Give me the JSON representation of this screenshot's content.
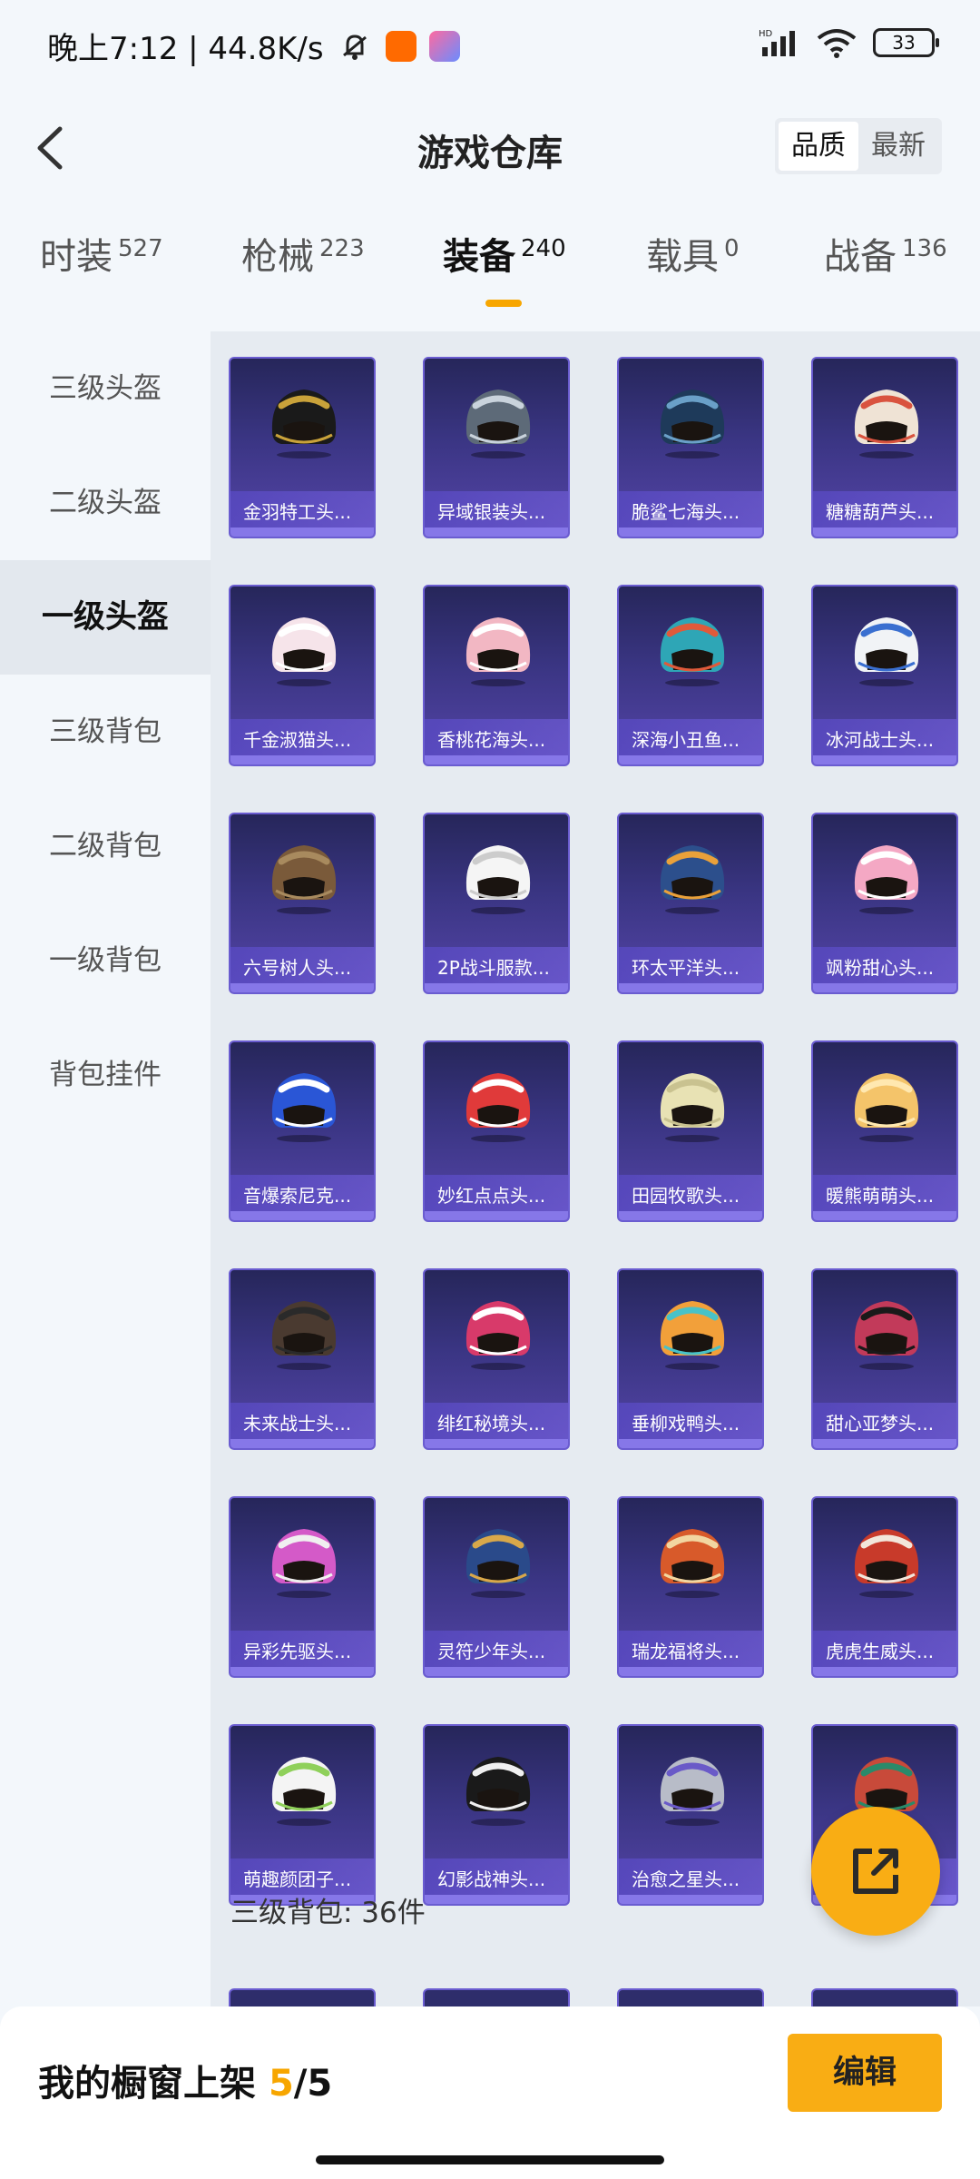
{
  "status_bar": {
    "time_network": "晚上7:12 | 44.8K/s",
    "battery": "33",
    "signal_label": "HD"
  },
  "header": {
    "title": "游戏仓库",
    "sort_options": [
      "品质",
      "最新"
    ],
    "sort_active": "品质"
  },
  "tabs": [
    {
      "label": "时装",
      "count": "527"
    },
    {
      "label": "枪械",
      "count": "223"
    },
    {
      "label": "装备",
      "count": "240"
    },
    {
      "label": "载具",
      "count": "0"
    },
    {
      "label": "战备",
      "count": "136"
    }
  ],
  "active_tab": "装备",
  "sidebar": {
    "items": [
      "三级头盔",
      "二级头盔",
      "一级头盔",
      "三级背包",
      "二级背包",
      "一级背包",
      "背包挂件"
    ],
    "active": "一级头盔"
  },
  "items": [
    {
      "name": "金羽特工头...",
      "colors": [
        "#1a1a1a",
        "#c9a23a"
      ]
    },
    {
      "name": "异域银装头...",
      "colors": [
        "#5d6a78",
        "#c9d3dc"
      ]
    },
    {
      "name": "脆鲨七海头...",
      "colors": [
        "#1e3a5a",
        "#6aa0c8"
      ]
    },
    {
      "name": "糖糖葫芦头...",
      "colors": [
        "#efe3d5",
        "#d9533f"
      ]
    },
    {
      "name": "千金淑猫头...",
      "colors": [
        "#f6e4ea",
        "#ffffff"
      ]
    },
    {
      "name": "香桃花海头...",
      "colors": [
        "#f2b7c3",
        "#ffffff"
      ]
    },
    {
      "name": "深海小丑鱼...",
      "colors": [
        "#2ea6b6",
        "#e05a3a"
      ]
    },
    {
      "name": "冰河战士头...",
      "colors": [
        "#f1f3f6",
        "#3a6fd0"
      ]
    },
    {
      "name": "六号树人头...",
      "colors": [
        "#7a5a3a",
        "#a88a5e"
      ]
    },
    {
      "name": "2P战斗服款...",
      "colors": [
        "#f5f5f5",
        "#cccccc"
      ]
    },
    {
      "name": "环太平洋头...",
      "colors": [
        "#2c4f8c",
        "#e9a13a"
      ]
    },
    {
      "name": "飒粉甜心头...",
      "colors": [
        "#f4a8c4",
        "#ffffff"
      ]
    },
    {
      "name": "音爆索尼克...",
      "colors": [
        "#2a56d6",
        "#ffffff"
      ]
    },
    {
      "name": "妙红点点头...",
      "colors": [
        "#e03a3a",
        "#ffffff"
      ]
    },
    {
      "name": "田园牧歌头...",
      "colors": [
        "#e8e2b4",
        "#c9c290"
      ]
    },
    {
      "name": "暖熊萌萌头...",
      "colors": [
        "#f4c46a",
        "#ffe8b0"
      ]
    },
    {
      "name": "未来战士头...",
      "colors": [
        "#4a3a30",
        "#2a2a2a"
      ]
    },
    {
      "name": "绯红秘境头...",
      "colors": [
        "#d83a6a",
        "#ffffff"
      ]
    },
    {
      "name": "垂柳戏鸭头...",
      "colors": [
        "#f2a03a",
        "#48c2c8"
      ]
    },
    {
      "name": "甜心亚梦头...",
      "colors": [
        "#c23a5a",
        "#1a1a1a"
      ]
    },
    {
      "name": "异彩先驱头...",
      "colors": [
        "#d45ac8",
        "#f0f0f0"
      ]
    },
    {
      "name": "灵符少年头...",
      "colors": [
        "#2a4a8a",
        "#d8a84a"
      ]
    },
    {
      "name": "瑞龙福将头...",
      "colors": [
        "#d85a2a",
        "#f2d6a0"
      ]
    },
    {
      "name": "虎虎生威头...",
      "colors": [
        "#c83a2a",
        "#f2e6da"
      ]
    },
    {
      "name": "萌趣颜团子...",
      "colors": [
        "#f4f4f4",
        "#8fd05a"
      ]
    },
    {
      "name": "幻影战神头...",
      "colors": [
        "#1a1a1a",
        "#f0f0f0"
      ]
    },
    {
      "name": "治愈之星头...",
      "colors": [
        "#b8bcc8",
        "#6a5ac8"
      ]
    },
    {
      "name": "",
      "colors": [
        "#c84a3a",
        "#2a8a6a"
      ]
    }
  ],
  "section": {
    "label": "三级背包: 36件"
  },
  "bottom": {
    "shelf_label": "我的橱窗上架",
    "shelf_count": "5",
    "shelf_total": "/5",
    "edit_label": "编辑"
  }
}
